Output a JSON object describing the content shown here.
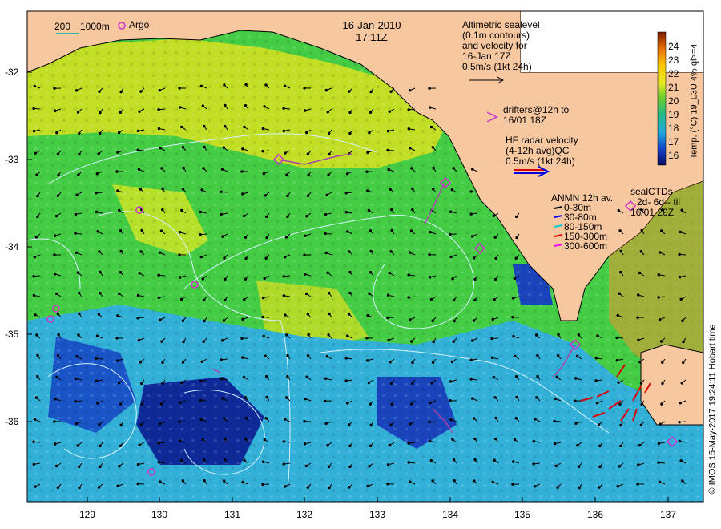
{
  "header": {
    "date": "16-Jan-2010",
    "time": "17:11Z",
    "scale_bar": {
      "a": "200",
      "b": "1000m"
    },
    "argo_label": "Argo"
  },
  "altimetry_note": {
    "lines": [
      "Altimetric sealevel",
      "(0.1m contours)",
      "and velocity for",
      "16-Jan 17Z",
      "0.5m/s (1kt 24h)"
    ]
  },
  "drifters_note": {
    "lines": [
      "drifters@12h to",
      "16/01 18Z"
    ]
  },
  "hf_radar_note": {
    "lines": [
      "HF radar velocity",
      "(4-12h avg)QC",
      "0.5m/s (1kt 24h)"
    ]
  },
  "anmn_legend": {
    "title": "ANMN 12h av.",
    "items": [
      {
        "label": "0-30m",
        "color": "#000000"
      },
      {
        "label": "30-80m",
        "color": "#0000ff"
      },
      {
        "label": "80-150m",
        "color": "#00cccc"
      },
      {
        "label": "150-300m",
        "color": "#dd0000"
      },
      {
        "label": "300-600m",
        "color": "#ff00ff"
      }
    ]
  },
  "seal_ctd_legend": {
    "lines": [
      "sealCTDs",
      "2d- 6d-- til",
      "16/01 20Z"
    ]
  },
  "colorbar": {
    "ticks": [
      "24",
      "23",
      "22",
      "21",
      "20",
      "19",
      "18",
      "17",
      "16"
    ],
    "title": "Temp. (°C) 19_L3U 4% ql>=4"
  },
  "axes": {
    "lat_ticks": [
      "-32",
      "-33",
      "-34",
      "-35",
      "-36"
    ],
    "lon_ticks": [
      "129",
      "130",
      "131",
      "132",
      "133",
      "134",
      "135",
      "136",
      "137"
    ]
  },
  "credit": "© IMOS 15-May-2017 19:24:11 Hobart time",
  "colors": {
    "land": "#f7c8a0",
    "warm": "#e8e820",
    "mid": "#33cc33",
    "cool": "#22aadd",
    "cold": "#1133aa",
    "contour": "#d0f0ff",
    "argo": "#cc33cc"
  }
}
